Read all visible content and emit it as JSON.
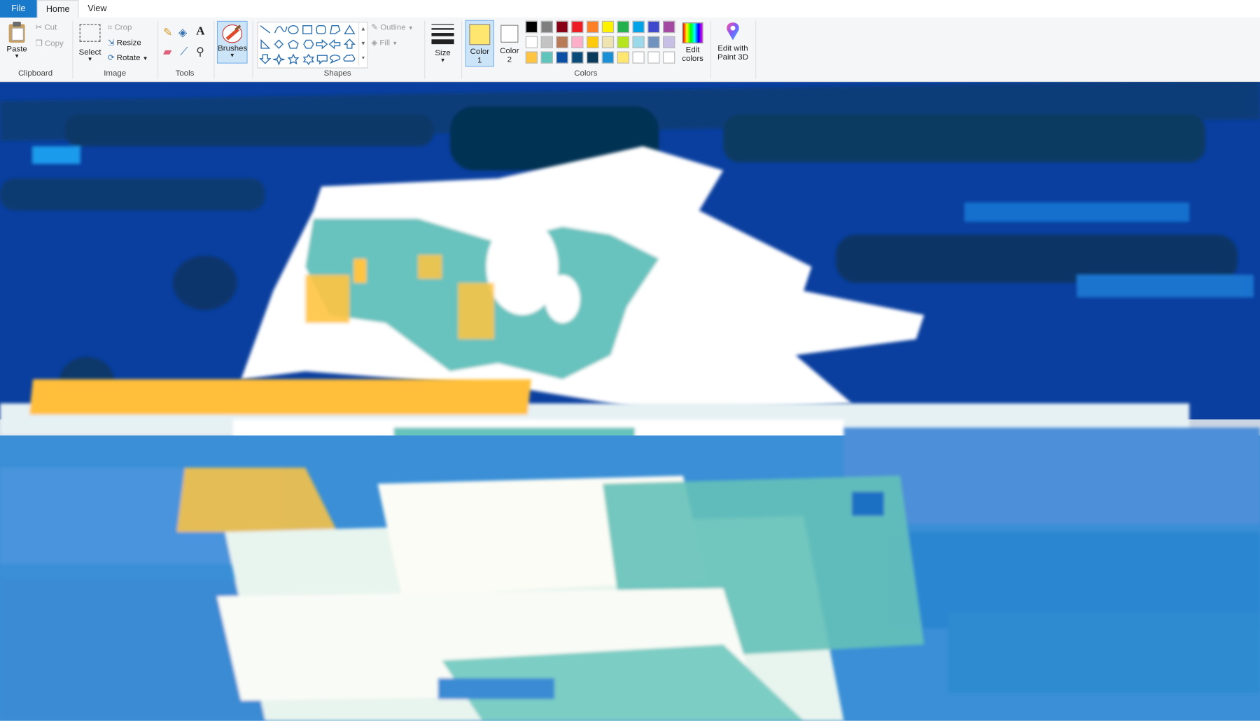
{
  "tabs": {
    "file": "File",
    "home": "Home",
    "view": "View"
  },
  "clipboard": {
    "paste": "Paste",
    "cut": "Cut",
    "copy": "Copy",
    "label": "Clipboard"
  },
  "image": {
    "select": "Select",
    "crop": "Crop",
    "resize": "Resize",
    "rotate": "Rotate",
    "label": "Image"
  },
  "tools": {
    "label": "Tools",
    "text_glyph": "A"
  },
  "brushes": {
    "label": "Brushes"
  },
  "shapes": {
    "label": "Shapes",
    "outline": "Outline",
    "fill": "Fill"
  },
  "size": {
    "label": "Size"
  },
  "colors": {
    "color1_label_line1": "Color",
    "color1_label_line2": "1",
    "color2_label_line1": "Color",
    "color2_label_line2": "2",
    "label": "Colors",
    "edit_line1": "Edit",
    "edit_line2": "colors",
    "color1": "#ffe66e",
    "color2": "#ffffff",
    "palette": [
      "#000000",
      "#7f7f7f",
      "#880015",
      "#ed1c24",
      "#ff7f27",
      "#fff200",
      "#22b14c",
      "#00a2e8",
      "#3f48cc",
      "#a349a4",
      "#ffffff",
      "#c3c3c3",
      "#b97a57",
      "#ffaec9",
      "#ffc90e",
      "#efe4b0",
      "#b5e61d",
      "#99d9ea",
      "#7092be",
      "#c8bfe7",
      "#ffc440",
      "#5fc4bc",
      "#0a4fa3",
      "#0b4b7a",
      "#0b3b5c",
      "#1b8fd6",
      "#ffe66e",
      "#ffffff",
      "#ffffff",
      "#ffffff"
    ]
  },
  "paint3d": {
    "line1": "Edit with",
    "line2": "Paint 3D"
  }
}
